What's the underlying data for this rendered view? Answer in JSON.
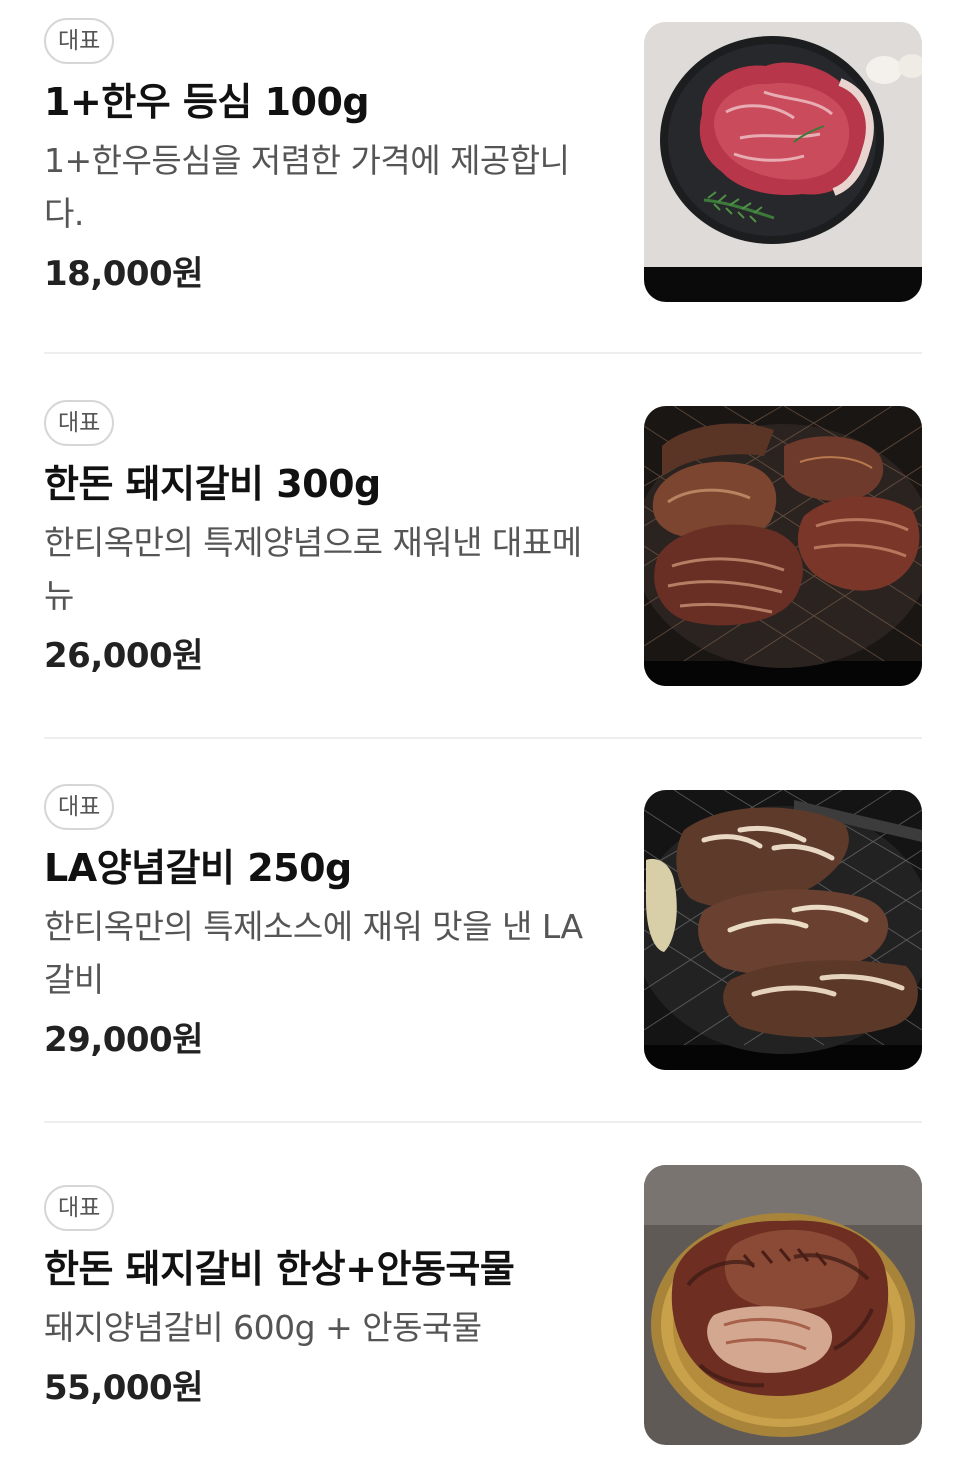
{
  "menu": {
    "items": [
      {
        "badge": "대표",
        "name": "1+한우 등심 100g",
        "description": "1+한우등심을 저렴한 가격에 제공합니다.",
        "price": "18,000원",
        "image": "beef-sirloin-on-slate"
      },
      {
        "badge": "대표",
        "name": "한돈 돼지갈비 300g",
        "description": "한티옥만의 특제양념으로 재워낸 대표메뉴",
        "price": "26,000원",
        "image": "pork-ribs-on-grill"
      },
      {
        "badge": "대표",
        "name": "LA양념갈비 250g",
        "description": "한티옥만의 특제소스에 재워 맛을 낸 LA갈비",
        "price": "29,000원",
        "image": "la-galbi-on-grill"
      },
      {
        "badge": "대표",
        "name": "한돈 돼지갈비 한상+안동국물",
        "description": "돼지양념갈비 600g + 안동국물",
        "price": "55,000원",
        "image": "pork-ribs-on-brass-plate"
      }
    ]
  },
  "colors": {
    "badge_border": "#d6d6d6",
    "text_primary": "#111111",
    "text_secondary": "#555555",
    "divider": "#eeeeee"
  }
}
